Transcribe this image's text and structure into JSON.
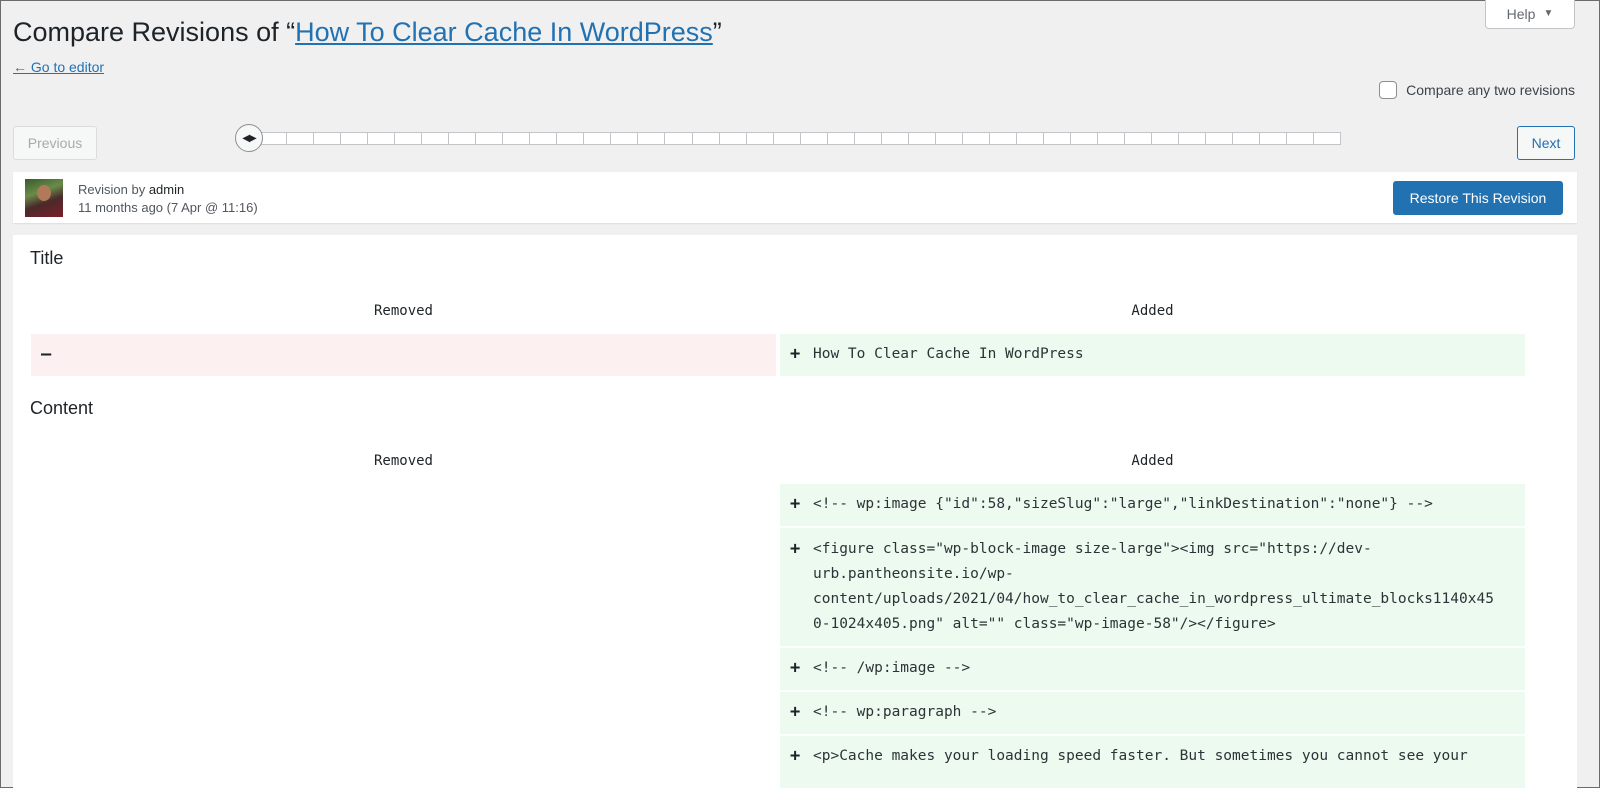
{
  "help": {
    "label": "Help"
  },
  "header": {
    "title_prefix": "Compare Revisions of “",
    "title_link": "How To Clear Cache In WordPress",
    "title_suffix": "”",
    "go_to_editor": "← Go to editor"
  },
  "compare_any": {
    "label": "Compare any two revisions",
    "checked": false
  },
  "nav": {
    "previous": "Previous",
    "next": "Next"
  },
  "revision": {
    "by_label": "Revision by ",
    "author": "admin",
    "time": "11 months ago (7 Apr @ 11:16)",
    "restore_label": "Restore This Revision"
  },
  "diff": {
    "title_section": {
      "label": "Title",
      "removed_header": "Removed",
      "added_header": "Added",
      "removed_sign": "–",
      "added_sign": "+",
      "added_text": "How To Clear Cache In WordPress"
    },
    "content_section": {
      "label": "Content",
      "removed_header": "Removed",
      "added_header": "Added",
      "added_rows": [
        {
          "sign": "+",
          "text": "<!-- wp:image {\"id\":58,\"sizeSlug\":\"large\",\"linkDestination\":\"none\"} -->"
        },
        {
          "sign": "+",
          "text": "<figure class=\"wp-block-image size-large\"><img src=\"https://dev-\nurb.pantheonsite.io/wp-\ncontent/uploads/2021/04/how_to_clear_cache_in_wordpress_ultimate_blocks1140x45\n0-1024x405.png\" alt=\"\" class=\"wp-image-58\"/></figure>"
        },
        {
          "sign": "+",
          "text": "<!-- /wp:image -->"
        },
        {
          "sign": "+",
          "text": "<!-- wp:paragraph -->"
        },
        {
          "sign": "+",
          "text": "<p>Cache makes your loading speed faster. But sometimes you cannot see your"
        }
      ]
    }
  },
  "colors": {
    "accent": "#2271b1",
    "removed_bg": "#fcf0f1",
    "added_bg": "#edfaef",
    "page_bg": "#f0f0f1"
  }
}
